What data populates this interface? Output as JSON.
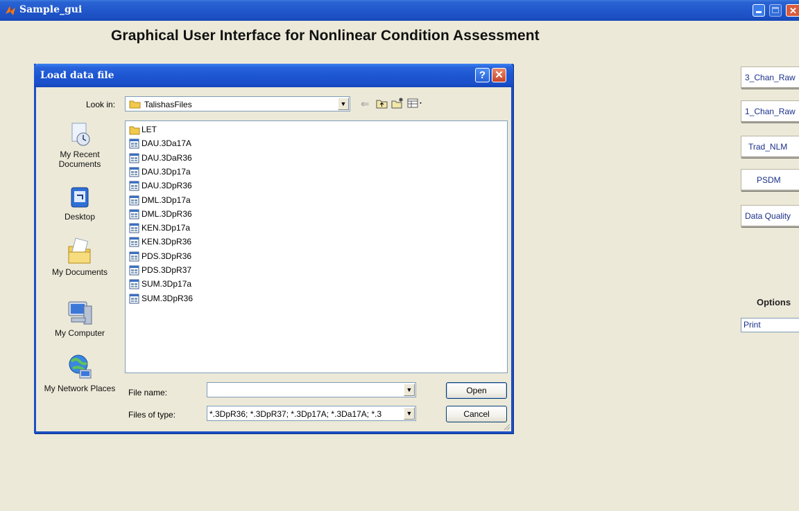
{
  "window": {
    "title": "Sample_gui",
    "heading": "Graphical User Interface for Nonlinear Condition Assessment",
    "buttons": [
      "minimize-icon",
      "maximize-icon",
      "close-icon"
    ]
  },
  "side_buttons": [
    {
      "label": "3_Chan_Raw"
    },
    {
      "label": "1_Chan_Raw"
    },
    {
      "label": "Trad_NLM"
    },
    {
      "label": "PSDM"
    },
    {
      "label": "Data Quality"
    }
  ],
  "options": {
    "label": "Options",
    "selected": "Print"
  },
  "dialog": {
    "title": "Load data file",
    "help_glyph": "?",
    "look_in_label": "Look in:",
    "look_in_value": "TalishasFiles",
    "places": [
      {
        "label": "My Recent Documents",
        "icon": "recent-documents-icon"
      },
      {
        "label": "Desktop",
        "icon": "desktop-icon"
      },
      {
        "label": "My Documents",
        "icon": "my-documents-icon"
      },
      {
        "label": "My Computer",
        "icon": "my-computer-icon"
      },
      {
        "label": "My Network Places",
        "icon": "network-places-icon"
      }
    ],
    "files": [
      {
        "name": "LET",
        "type": "folder"
      },
      {
        "name": "DAU.3Da17A",
        "type": "file"
      },
      {
        "name": "DAU.3DaR36",
        "type": "file"
      },
      {
        "name": "DAU.3Dp17a",
        "type": "file"
      },
      {
        "name": "DAU.3DpR36",
        "type": "file"
      },
      {
        "name": "DML.3Dp17a",
        "type": "file"
      },
      {
        "name": "DML.3DpR36",
        "type": "file"
      },
      {
        "name": "KEN.3Dp17a",
        "type": "file"
      },
      {
        "name": "KEN.3DpR36",
        "type": "file"
      },
      {
        "name": "PDS.3DpR36",
        "type": "file"
      },
      {
        "name": "PDS.3DpR37",
        "type": "file"
      },
      {
        "name": "SUM.3Dp17a",
        "type": "file"
      },
      {
        "name": "SUM.3DpR36",
        "type": "file"
      }
    ],
    "file_name_label": "File name:",
    "file_name_value": "",
    "file_type_label": "Files of type:",
    "file_type_value": "*.3DpR36; *.3DpR37; *.3Dp17A; *.3Da17A; *.3",
    "open_label": "Open",
    "cancel_label": "Cancel"
  },
  "colors": {
    "titlebar": "#1f55c9",
    "window_bg": "#ece9d8",
    "close_red": "#d95b3c",
    "link_text": "#1a2f8a"
  }
}
